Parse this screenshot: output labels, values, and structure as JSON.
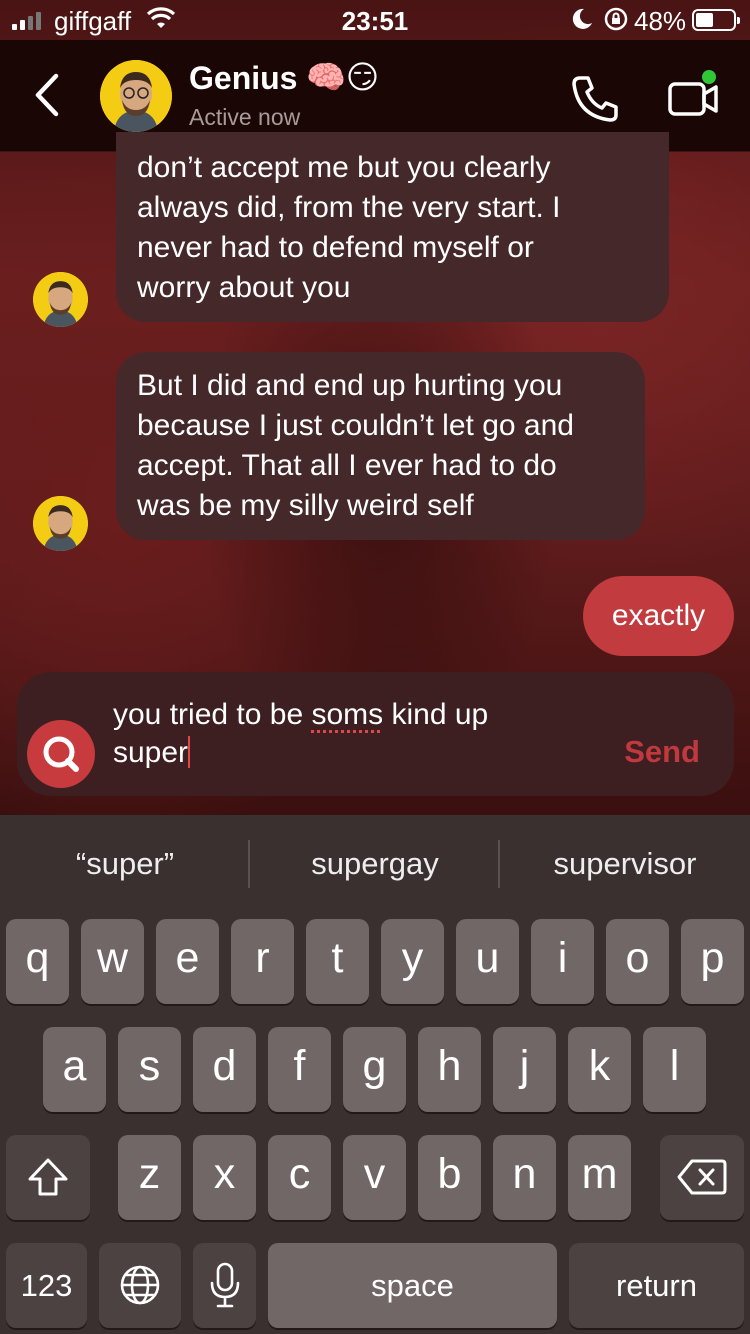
{
  "status_bar": {
    "carrier": "giffgaff",
    "time": "23:51",
    "battery_percent": "48%",
    "battery_level": 0.48,
    "signal_bars_total": 4,
    "signal_bars_active": 2
  },
  "header": {
    "contact_name": "Genius",
    "contact_emoji": "🧠😏",
    "contact_status": "Active now",
    "icons": {
      "back": "chevron-left-icon",
      "call": "phone-icon",
      "video": "video-camera-icon"
    }
  },
  "messages": [
    {
      "direction": "incoming",
      "lines": [
        "don’t accept me but you clearly",
        "always did, from the very start. I",
        "never had to defend myself or",
        "worry about you"
      ]
    },
    {
      "direction": "incoming",
      "lines": [
        "But I did and end up hurting you",
        "because I just couldn’t let go and",
        "accept. That all I ever had to do",
        "was be my silly weird self"
      ]
    },
    {
      "direction": "outgoing",
      "text": "exactly"
    }
  ],
  "composer": {
    "text_before": "you tried to be ",
    "misspelled_word": "soms",
    "text_after_line1": " kind up",
    "text_line2": "super",
    "send_label": "Send",
    "search_icon": "magnifier-icon"
  },
  "keyboard": {
    "suggestions": [
      "“super”",
      "supergay",
      "supervisor"
    ],
    "row1": [
      "q",
      "w",
      "e",
      "r",
      "t",
      "y",
      "u",
      "i",
      "o",
      "p"
    ],
    "row2": [
      "a",
      "s",
      "d",
      "f",
      "g",
      "h",
      "j",
      "k",
      "l"
    ],
    "row3": [
      "z",
      "x",
      "c",
      "v",
      "b",
      "n",
      "m"
    ],
    "numbers_label": "123",
    "space_label": "space",
    "return_label": "return",
    "icons": {
      "shift": "shift-arrow-icon",
      "delete": "backspace-icon",
      "globe": "globe-icon",
      "mic": "microphone-icon"
    }
  },
  "colors": {
    "accent": "#c23b3f",
    "incoming_bubble": "#45282a",
    "header_bg": "#1b0606",
    "keyboard_bg": "#3a3030",
    "key_bg": "#716767",
    "online_dot": "#31c635"
  }
}
